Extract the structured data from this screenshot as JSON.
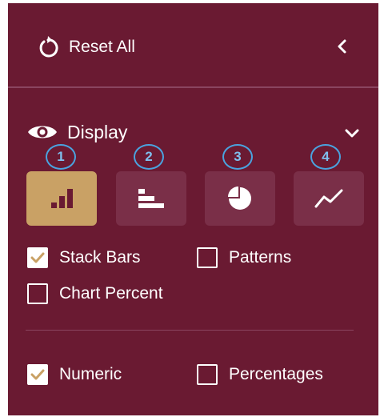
{
  "reset": {
    "label": "Reset All"
  },
  "display": {
    "label": "Display"
  },
  "chart_types": [
    {
      "number": "1",
      "icon": "bar-chart-icon",
      "active": true
    },
    {
      "number": "2",
      "icon": "horizontal-bar-chart-icon",
      "active": false
    },
    {
      "number": "3",
      "icon": "pie-chart-icon",
      "active": false
    },
    {
      "number": "4",
      "icon": "line-chart-icon",
      "active": false
    }
  ],
  "options": {
    "stack_bars": {
      "label": "Stack Bars",
      "checked": true
    },
    "patterns": {
      "label": "Patterns",
      "checked": false
    },
    "chart_percent": {
      "label": "Chart Percent",
      "checked": false
    }
  },
  "values": {
    "numeric": {
      "label": "Numeric",
      "checked": true
    },
    "percentages": {
      "label": "Percentages",
      "checked": false
    }
  },
  "colors": {
    "panel_bg": "#6a1a32",
    "active_button": "#c9a165",
    "inactive_button": "#7a2f48",
    "badge_outline": "#4aa3df",
    "check_mark": "#c9a165"
  }
}
